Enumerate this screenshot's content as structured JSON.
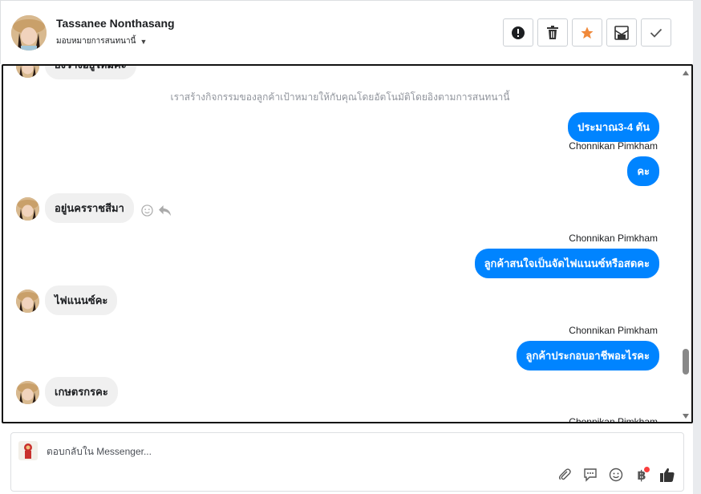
{
  "header": {
    "contact_name": "Tassanee Nonthasang",
    "assign_label": "มอบหมายการสนทนานี้",
    "actions": [
      "report-icon",
      "trash-icon",
      "star-icon",
      "archive-icon",
      "check-icon"
    ],
    "colors": {
      "star": "#f0893a",
      "border": "#ccd0d5"
    }
  },
  "conversation": {
    "partial_top_message": "ยังว่างอยู่ไหมคะ",
    "system_note": "เราสร้างกิจกรรมของลูกค้าเป้าหมายให้กับคุณโดยอัตโนมัติโดยอิงตามการสนทนานี้",
    "agent_name": "Chonnikan Pimkham",
    "messages": [
      {
        "dir": "out",
        "text": "ประมาณ3-4 ตัน"
      },
      {
        "dir": "sender",
        "text": "Chonnikan Pimkham"
      },
      {
        "dir": "out",
        "text": "คะ"
      },
      {
        "dir": "in",
        "text": "อยู่นครราชสีมา"
      },
      {
        "dir": "sender",
        "text": "Chonnikan Pimkham"
      },
      {
        "dir": "out",
        "text": "ลูกค้าสนใจเป็นจัดไฟแนนซ์หรือสดคะ"
      },
      {
        "dir": "in",
        "text": "ไฟแนนซ์คะ"
      },
      {
        "dir": "sender",
        "text": "Chonnikan Pimkham"
      },
      {
        "dir": "out",
        "text": "ลูกค้าประกอบอาชีพอะไรคะ"
      },
      {
        "dir": "in",
        "text": "เกษตรกรคะ"
      },
      {
        "dir": "sender",
        "text": "Chonnikan Pimkham"
      }
    ],
    "colors": {
      "outgoing": "#0084ff",
      "incoming": "#f0f0f0"
    }
  },
  "composer": {
    "placeholder": "ตอบกลับใน Messenger...",
    "tools": [
      "attachment-icon",
      "saved-reply-icon",
      "emoji-icon",
      "payment-icon",
      "like-icon"
    ],
    "currency_symbol": "฿"
  }
}
